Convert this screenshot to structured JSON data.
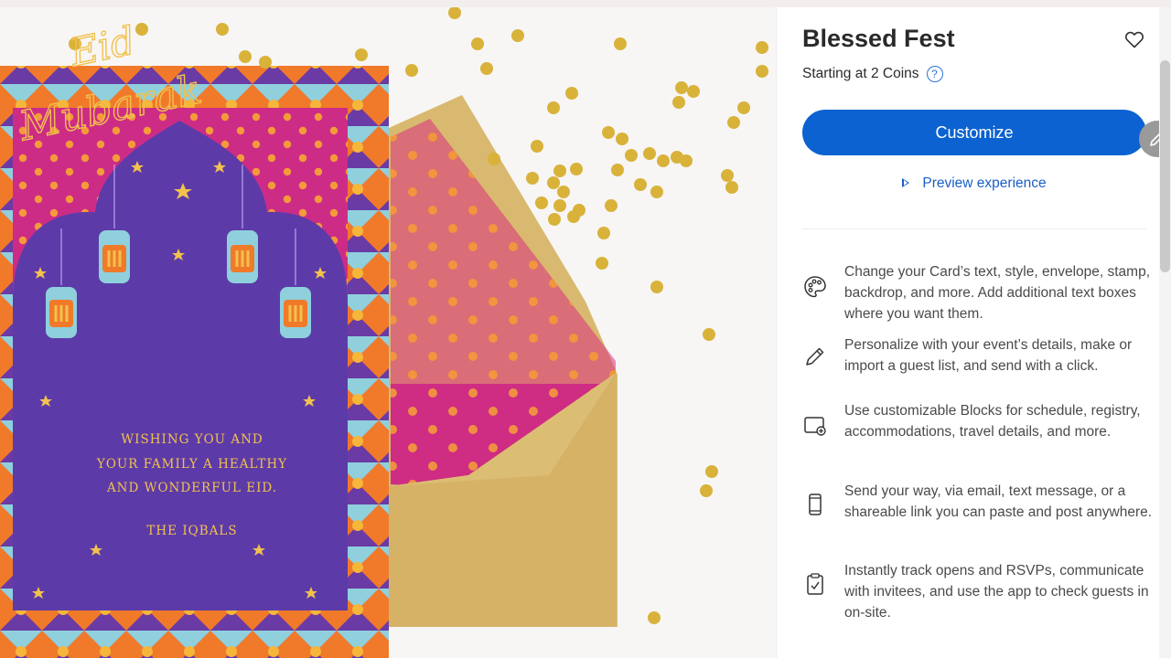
{
  "product": {
    "title": "Blessed Fest",
    "price": "Starting at 2 Coins",
    "help_icon": "question-circle-icon",
    "favorite_icon": "heart-outline-icon"
  },
  "actions": {
    "customize_label": "Customize",
    "preview_label": "Preview experience",
    "edit_icon": "pencil-icon"
  },
  "features": [
    {
      "icon": "palette-icon",
      "text": "Change your Card’s text, style, envelope, stamp, backdrop, and more. Add additional text boxes where you want them."
    },
    {
      "icon": "pencil-icon",
      "text": "Personalize with your event’s details, make or import a guest list, and send with a click."
    },
    {
      "icon": "blocks-add-icon",
      "text": "Use customizable Blocks for schedule, registry, accommodations, travel details, and more."
    },
    {
      "icon": "phone-icon",
      "text": "Send your way, via email, text message, or a shareable link you can paste and post anywhere."
    },
    {
      "icon": "clipboard-check-icon",
      "text": "Instantly track opens and RSVPs, communicate with invitees, and use the app to check guests in on-site."
    }
  ],
  "card": {
    "script_line1": "Eid",
    "script_line2": "Mubarak",
    "wish_line1": "WISHING YOU AND",
    "wish_line2": "YOUR FAMILY A HEALTHY",
    "wish_line3": "AND WONDERFUL EID.",
    "signature": "THE IQBALS"
  },
  "colors": {
    "accent_blue": "#0b62d0",
    "link_blue": "#1a5fc5",
    "card_magenta": "#cf2c83",
    "card_purple": "#5b3aa6",
    "card_gold": "#f2c14e",
    "envelope_kraft": "#d7b56d",
    "confetti_gold": "#d9b23a"
  }
}
